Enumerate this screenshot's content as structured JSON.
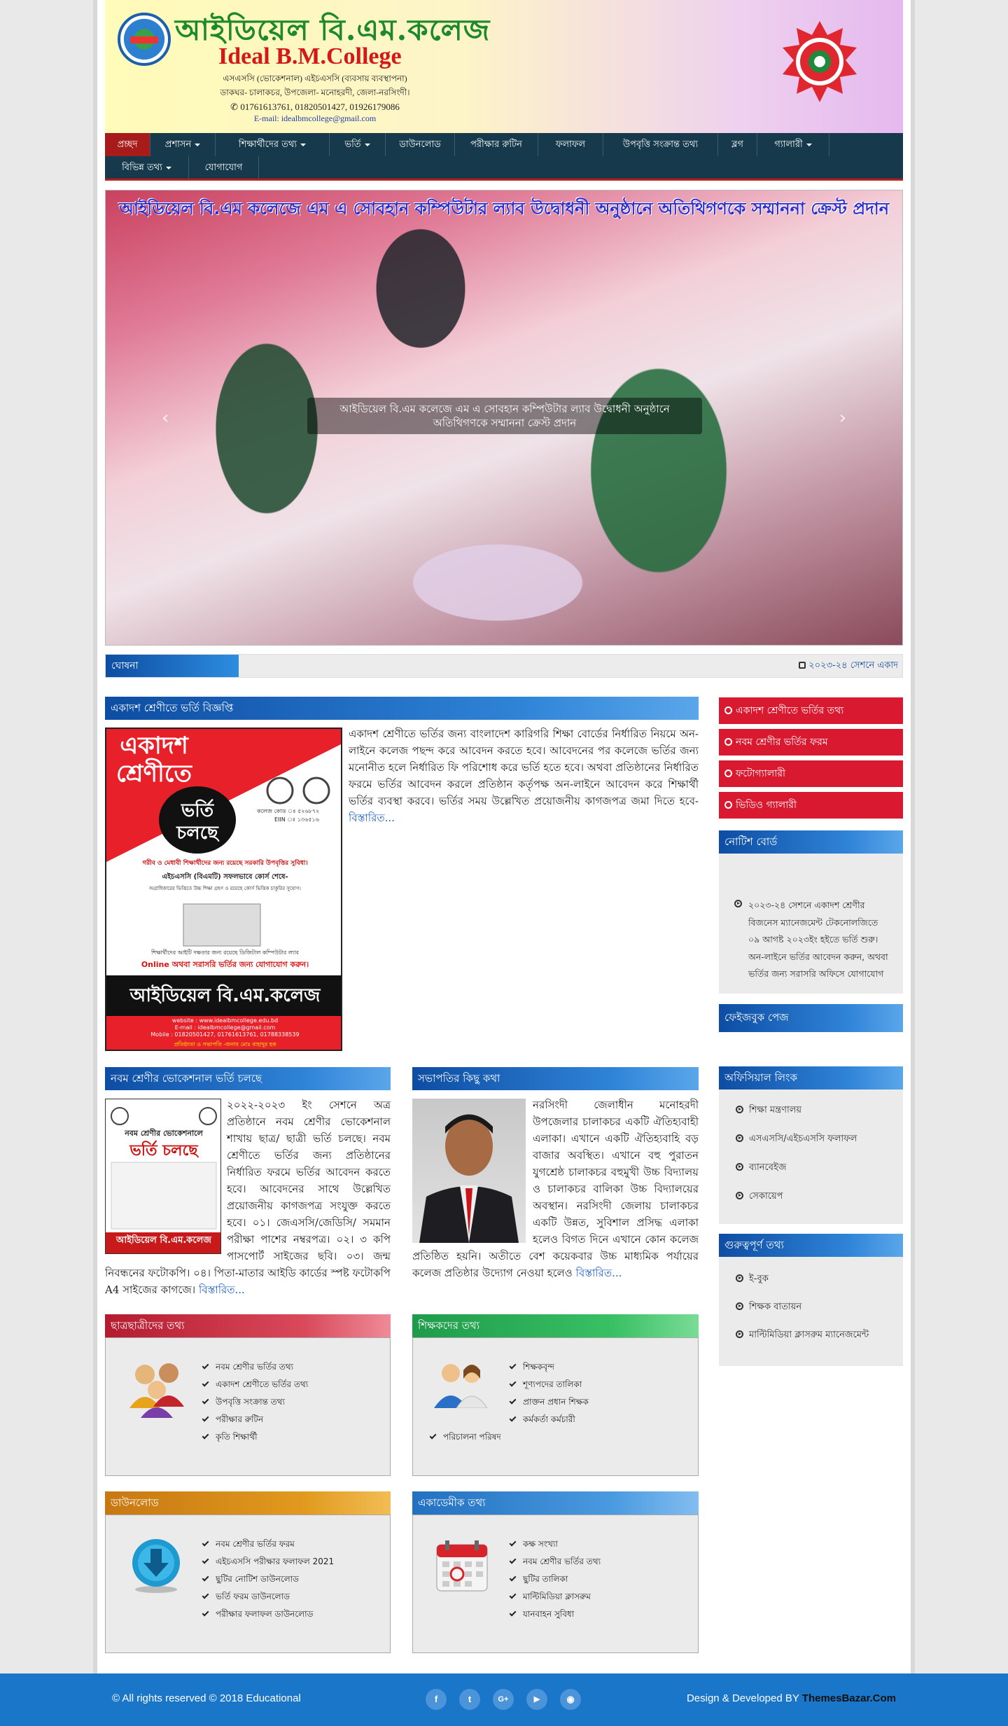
{
  "header": {
    "title_bn": "আইডিয়েল বি.এম.কলেজ",
    "title_en": "Ideal B.M.College",
    "line1": "এসএসসি (ভোকেশনাল) এইচএসসি (ব্যবসায় ব্যবস্থাপনা)",
    "line2": "ডাকঘর- চালাকচর, উপজেলা- মনোহরদী, জেলা-নরসিংদী।",
    "phones": "01761613761, 01820501427, 01926179086",
    "email": "E-mail: idealbmcollege@gmail.com"
  },
  "nav": {
    "items": [
      {
        "label": "প্রচ্ছদ"
      },
      {
        "label": "প্রশাসন"
      },
      {
        "label": "শিক্ষার্থীদের তথ্য"
      },
      {
        "label": "ভর্তি"
      },
      {
        "label": "ডাউনলোড"
      },
      {
        "label": "পরীক্ষার রুটিন"
      },
      {
        "label": "ফলাফল"
      },
      {
        "label": "উপবৃত্তি সংক্রান্ত তথ্য"
      },
      {
        "label": "ব্লগ"
      },
      {
        "label": "গ্যালারী"
      },
      {
        "label": "বিভিন্ন তথ্য"
      },
      {
        "label": "যোগাযোগ"
      }
    ]
  },
  "slider": {
    "title": "আইডিয়েল বি.এম কলেজে এম এ সোবহান কম্পিউটার ল্যাব উদ্বোধনী অনুষ্ঠানে অতিথিগণকে সম্মাননা ক্রেস্ট প্রদান",
    "caption": "আইডিয়েল বি.এম কলেজে এম এ সোবহান কম্পিউটার ল্যাব উদ্বোধনী অনুষ্ঠানে অতিথিগণকে সম্মাননা ক্রেস্ট প্রদান"
  },
  "announcement": {
    "label": "ঘোষনা",
    "text": "২০২৩-২৪ সেশনে একাদ"
  },
  "admission11": {
    "heading": "একাদশ শ্রেণীতে ভর্তি বিজ্ঞপ্তি",
    "body": "একাদশ শ্রেণীতে ভর্তির জন্য বাংলাদেশ কারিগরি শিক্ষা বোর্ডের নির্ধারিত নিয়মে অন-লাইনে কলেজ পছন্দ করে আবেদন করতে হবে। আবেদনের পর কলেজে ভর্তির জন্য মনোনীত হলে নির্ধারিত ফি পরিশোধ করে ভর্তি হতে হবে। অথবা প্রতিষ্ঠানের নির্ধারিত ফরমে ভর্তির আবেদন করলে প্রতিষ্ঠান কর্তৃপক্ষ অন-লাইনে আবেদন করে শিক্ষার্থী ভর্তির ব্যবস্থা করবে। ভর্তির সময় উল্লেখিত প্রয়োজনীয় কাগজপত্র জমা দিতে হবে-",
    "more": "বিস্তারিত...",
    "poster": {
      "top": "একাদশ শ্রেণীতে",
      "badge_line1": "ভর্তি",
      "badge_line2": "চলছে",
      "code": "কলেজ কোড ঃ ৫২৬৮৭২",
      "eiin": "EIIN ঃ ১৩৬৫১৬",
      "line_a": "গরীব ও মেধাবী শিক্ষার্থীদের জন্য রয়েছে সরকারি উপবৃত্তির সুবিধা।",
      "line_b": "এইচএসসি (বিএমটি) সফলভাবে কোর্স শেষে-",
      "line_c": "অগ্রাধিকারের ভিত্তিতে উচ্চ শিক্ষা গ্রহণ ও রয়েছে কোর্স ভিত্তিক চাকুরির সুযোগ।",
      "line_d": "শিক্ষার্থীদের আইটি দক্ষতার জন্য রয়েছে ডিজিটাল কম্পিউটার ল্যাব",
      "line_e": "Online অথবা সরাসরি ভর্তির জন্য যোগাযোগ করুন।",
      "name": "আইডিয়েল বি.এম.কলেজ",
      "web": "website : www.idealbmcollege.edu.bd",
      "mail": "E-mail : idealbmcollege@gmail.com",
      "mobile": "Mobile : 01820501427, 01761613761, 01788338539",
      "founder": "প্রতিষ্ঠাতা ও সভাপতি -জনাব মোঃ বাহাদুর হক"
    }
  },
  "admission9": {
    "heading": "নবম শ্রেণীর ভোকেশনাল ভর্তি চলছে",
    "body": "২০২২-২০২৩ ইং সেশনে অত্র প্রতিষ্ঠানে নবম শ্রেণীর ভোকেশনাল শাখায় ছাত্র/ ছাত্রী ভর্তি চলছে। নবম শ্রেণীতে ভর্তির জন্য প্রতিষ্ঠানের নির্ধারিত ফরমে ভর্তির আবেদন করতে হবে। আবেদনের সাথে উল্লেখিত প্রয়োজনীয় কাগজপত্র সংযুক্ত করতে হবে। ০১। জেএসসি/জেডিসি/ সমমান পরীক্ষা পাশের নম্বরপত্র। ০২। ৩ কপি পাসপোর্ট সাইজের ছবি। ০৩। জন্ম নিবন্ধনের ফটোকপি। ০৪। পিতা-মাতার আইডি কার্ডের স্পষ্ট ফটোকপি A4 সাইজের কাগজে।",
    "more": "বিস্তারিত...",
    "poster_title": "নবম শ্রেণীর ভোকেশনালে",
    "poster_badge": "ভর্তি চলছে",
    "poster_name": "আইডিয়েল বি.এম.কলেজ"
  },
  "president": {
    "heading": "সভাপতির কিছু কথা",
    "body": "নরসিংদী জেলাধীন মনোহরদী উপজেলার চালাকচর একটি ঐতিহ্যবাহী এলাকা। এখানে একটি ঐতিহ্যবাহি বড় বাজার অবস্থিত। এখানে বহু পুরাতন যুগশ্রেষ্ঠ চালাকচর বহুমুখী উচ্চ বিদ্যালয় ও চালাকচর বালিকা উচ্চ বিদ্যালয়ের অবস্থান। নরসিংদী জেলায় চালাকচর একটি উন্নত, সুবিশাল প্রসিদ্ধ এলাকা হলেও বিগত দিনে এখানে কোন কলেজ প্রতিষ্ঠিত হয়নি। অতীতে বেশ কয়েকবার উচ্চ মাধ্যমিক পর্যায়ের কলেজ প্রতিষ্ঠার উদ্যোগ নেওয়া হলেও",
    "more": "বিস্তারিত..."
  },
  "sidebar": {
    "buttons": [
      {
        "label": "একাদশ শ্রেণীতে ভর্তির তথ্য"
      },
      {
        "label": "নবম শ্রেণীর ভর্তির ফরম"
      },
      {
        "label": "ফটোগ্যালারী"
      },
      {
        "label": "ভিডিও গ্যালারী"
      }
    ],
    "notice_heading": "নোটিশ বোর্ড",
    "notice_text": "২০২৩-২৪ সেশনে একাদশ শ্রেণীর বিজনেস ম্যানেজমেন্ট টেকনোলজিতে ০৯ আগষ্ট ২০২৩ইং হইতে ভর্তি শুরু। অন-লাইনে ভর্তির আবেদন করুন, অথবা ভর্তির জন্য সরাসরি অফিসে যোগাযোগ",
    "facebook_heading": "ফেইজবুক পেজ",
    "official_heading": "অফিসিয়াল লিংক",
    "official_links": [
      {
        "label": "শিক্ষা মন্ত্রণালয়"
      },
      {
        "label": "এসএসসি/এইচএসসি ফলাফল"
      },
      {
        "label": "ব্যানবেইজ"
      },
      {
        "label": "সেকায়েপ"
      }
    ],
    "important_heading": "গুরুত্বপূর্ণ তথ্য",
    "important_links": [
      {
        "label": "ই-বুক"
      },
      {
        "label": "শিক্ষক বাতায়ন"
      },
      {
        "label": "মাল্টিমিডিয়া ক্লাসরুম ম্যানেজমেন্ট"
      }
    ]
  },
  "students_box": {
    "heading": "ছাত্রছাত্রীদের তথ্য",
    "items": [
      "নবম শ্রেণীর ভর্তির তথ্য",
      "একাদশ শ্রেণীতে ভর্তির তথ্য",
      "উপবৃত্তি সংক্রান্ত তথ্য",
      "পরীক্ষার রুটিন",
      "কৃতি শিক্ষার্থী"
    ]
  },
  "teachers_box": {
    "heading": "শিক্ষকদের তথ্য",
    "items": [
      "শিক্ষকবৃন্দ",
      "শূণ্যপদের তালিকা",
      "প্রাক্তন প্রধান শিক্ষক",
      "কর্মকর্তা কর্মচারী",
      "পরিচালনা পরিষদ"
    ]
  },
  "download_box": {
    "heading": "ডাউনলোড",
    "items": [
      "নবম শ্রেণীর ভর্তির ফরম",
      "এইচএসসি পরীক্ষার ফলাফল 2021",
      "ছুটির নোটিশ ডাউনলোড",
      "ভর্তি ফরম ডাউনলোড",
      "পরীক্ষার ফলাফল ডাউনলোড"
    ]
  },
  "academic_box": {
    "heading": "একাডেমীক তথ্য",
    "items": [
      "কক্ষ সংখ্যা",
      "নবম শ্রেণীর ভর্তির তথ্য",
      "ছুটির তালিকা",
      "মাল্টিমিডিয়া ক্লাসরুম",
      "যানবাহন সুবিধা"
    ]
  },
  "footer": {
    "copyright": "© All rights reserved © 2018 Educational",
    "credit_prefix": "Design & Developed BY",
    "credit_name": "ThemesBazar.Com",
    "social": [
      {
        "name": "facebook-icon",
        "glyph": "f"
      },
      {
        "name": "twitter-icon",
        "glyph": "t"
      },
      {
        "name": "google-plus-icon",
        "glyph": "G+"
      },
      {
        "name": "youtube-icon",
        "glyph": "▶"
      },
      {
        "name": "rss-icon",
        "glyph": "◉"
      }
    ]
  }
}
